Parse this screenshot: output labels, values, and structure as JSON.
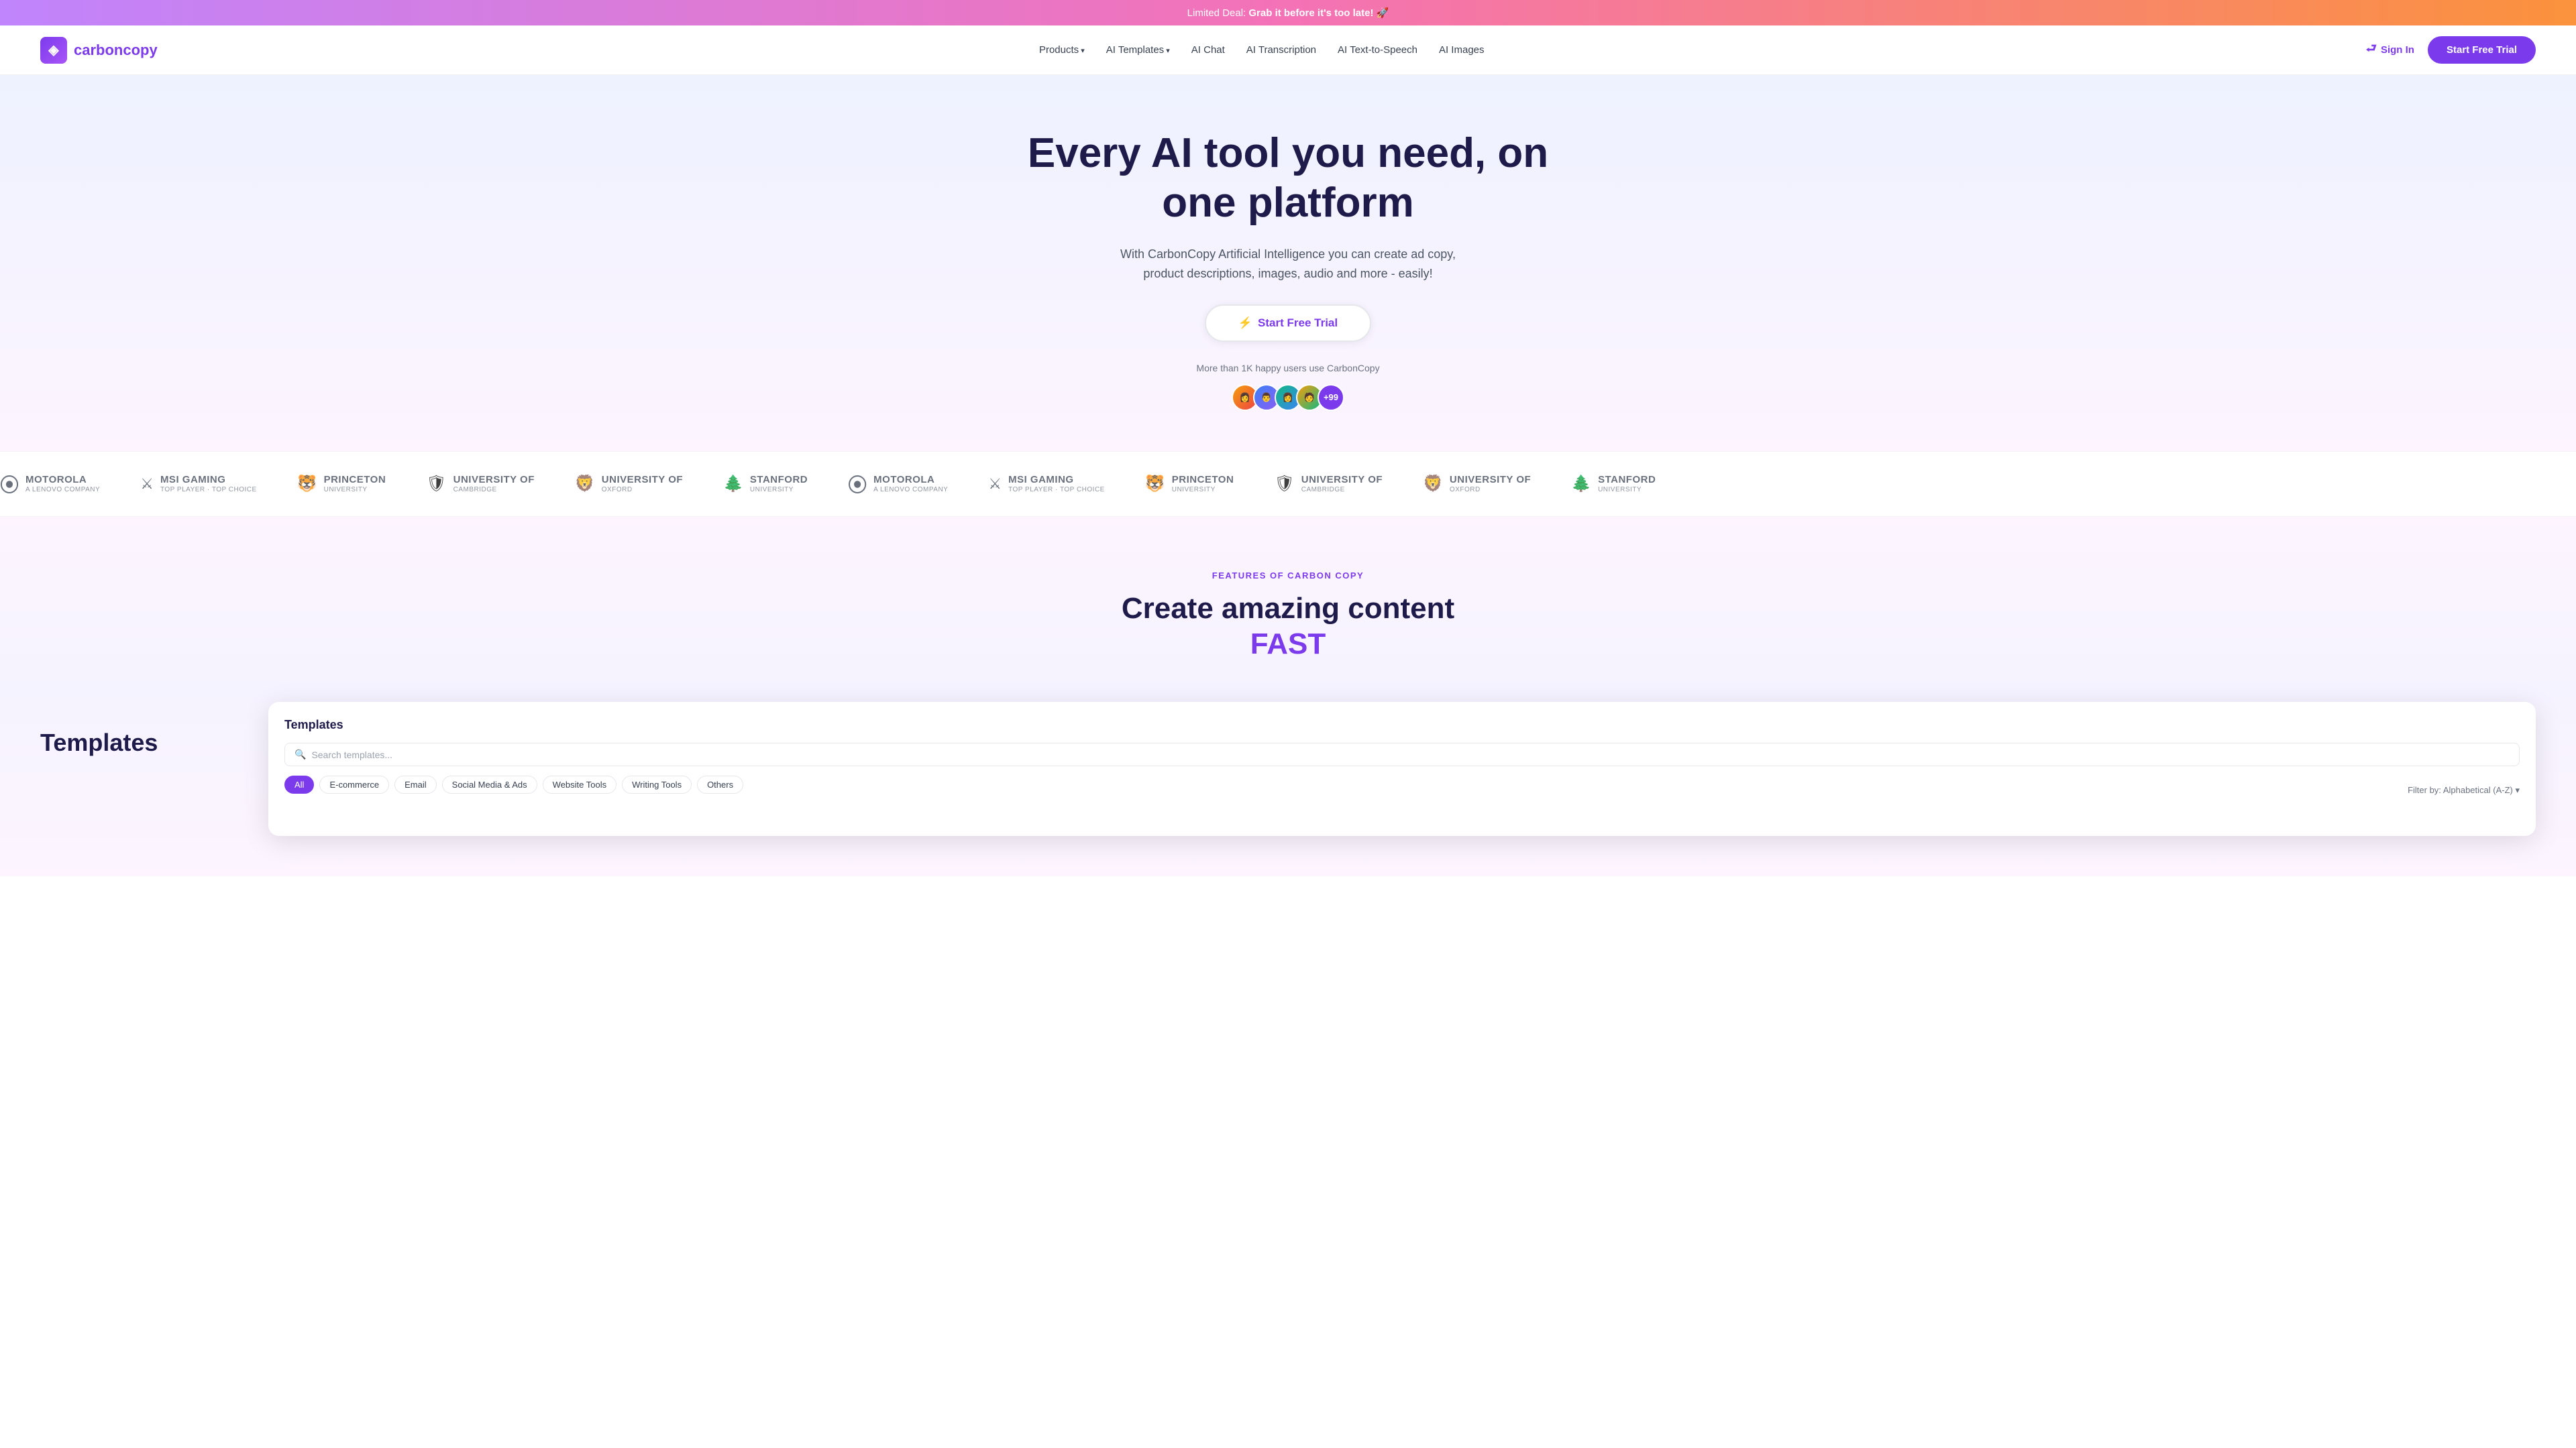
{
  "banner": {
    "text": "Limited Deal: ",
    "bold": "Grab it before it's too late! 🚀"
  },
  "navbar": {
    "logo_text_carbon": "carbon",
    "logo_text_copy": "copy",
    "links": [
      {
        "id": "products",
        "label": "Products",
        "hasArrow": true
      },
      {
        "id": "ai-templates",
        "label": "AI Templates",
        "hasArrow": true
      },
      {
        "id": "ai-chat",
        "label": "AI Chat",
        "hasArrow": false
      },
      {
        "id": "ai-transcription",
        "label": "AI Transcription",
        "hasArrow": false
      },
      {
        "id": "ai-text-to-speech",
        "label": "AI Text-to-Speech",
        "hasArrow": false
      },
      {
        "id": "ai-images",
        "label": "AI Images",
        "hasArrow": false
      }
    ],
    "sign_in": "Sign In",
    "trial_button": "Start Free Trial"
  },
  "hero": {
    "heading_line1": "Every AI tool you need, on",
    "heading_line2": "one platform",
    "subtext": "With CarbonCopy Artificial Intelligence you can create ad copy, product descriptions, images, audio and more - easily!",
    "cta_button": "Start Free Trial",
    "social_proof_text": "More than 1K happy users use CarbonCopy",
    "avatar_count": "+99"
  },
  "logos": [
    {
      "id": "motorola",
      "name": "motorola",
      "sub": "A Lenovo Company",
      "symbol": "M"
    },
    {
      "id": "msi-gaming",
      "name": "MSI GAMING",
      "sub": "TOP PLAYER · TOP CHOICE",
      "symbol": "⚔"
    },
    {
      "id": "princeton",
      "name": "PRINCETON",
      "sub": "UNIVERSITY",
      "symbol": "🐯"
    },
    {
      "id": "cambridge",
      "name": "UNIVERSITY OF",
      "sub": "CAMBRIDGE",
      "symbol": "🛡"
    },
    {
      "id": "oxford",
      "name": "UNIVERSITY OF",
      "sub": "OXFORD",
      "symbol": "🦁"
    },
    {
      "id": "stanford",
      "name": "Stanford",
      "sub": "University",
      "symbol": "🌲"
    }
  ],
  "features": {
    "tag": "FEATURES OF CARBON COPY",
    "heading": "Create amazing content",
    "heading_accent": "FAST"
  },
  "templates": {
    "section_title": "Templates",
    "preview_title": "Templates",
    "search_placeholder": "Search templates...",
    "tabs": [
      {
        "label": "All",
        "active": true
      },
      {
        "label": "E-commerce",
        "active": false
      },
      {
        "label": "Email",
        "active": false
      },
      {
        "label": "Social Media & Ads",
        "active": false
      },
      {
        "label": "Website Tools",
        "active": false
      },
      {
        "label": "Writing Tools",
        "active": false
      },
      {
        "label": "Others",
        "active": false
      }
    ],
    "filter_label": "Filter by: Alphabetical (A-Z) ▾"
  }
}
